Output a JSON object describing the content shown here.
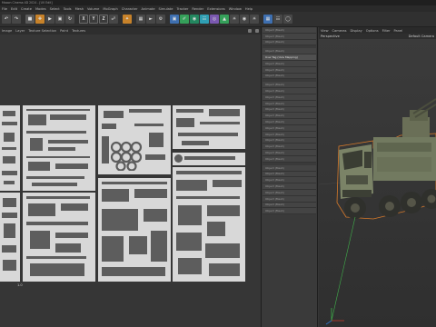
{
  "window": {
    "title": "Maxon Cinema 4D 2024 - [UV Edit]"
  },
  "menubar": [
    "File",
    "Edit",
    "Create",
    "Modes",
    "Select",
    "Tools",
    "Mesh",
    "Volume",
    "MoGraph",
    "Character",
    "Animate",
    "Simulate",
    "Tracker",
    "Render",
    "Extensions",
    "Window",
    "Help"
  ],
  "toolbar": {
    "axes": [
      "X",
      "Y",
      "Z"
    ]
  },
  "uv_editor": {
    "menu": [
      "Image",
      "Layer",
      "Texture Selection",
      "Paint",
      "Textures"
    ],
    "tick_label": "1.0"
  },
  "objects": {
    "items": [
      "Object (Mesh)",
      "Object (Mesh)",
      "Object (Mesh)",
      "Object (Mesh)",
      "Uvw Tag (Uvw Mapping)",
      "Object (Mesh)",
      "Object (Mesh)",
      "Object (Mesh)",
      "Object (Mesh)",
      "Object (Mesh)",
      "Object (Mesh)",
      "Object (Mesh)",
      "Object (Mesh)",
      "Object (Mesh)",
      "Object (Mesh)",
      "Object (Mesh)",
      "Object (Mesh)",
      "Object (Mesh)",
      "Object (Mesh)",
      "Object (Mesh)",
      "Object (Mesh)",
      "Object (Mesh)",
      "Object (Mesh)",
      "Object (Mesh)",
      "Object (Mesh)",
      "Object (Mesh)",
      "Object (Mesh)",
      "Object (Mesh)",
      "Object (Mesh)"
    ]
  },
  "viewport": {
    "menu": [
      "View",
      "Cameras",
      "Display",
      "Options",
      "Filter",
      "Panel"
    ],
    "label_left": "Perspective",
    "label_right": "Default Camera"
  }
}
